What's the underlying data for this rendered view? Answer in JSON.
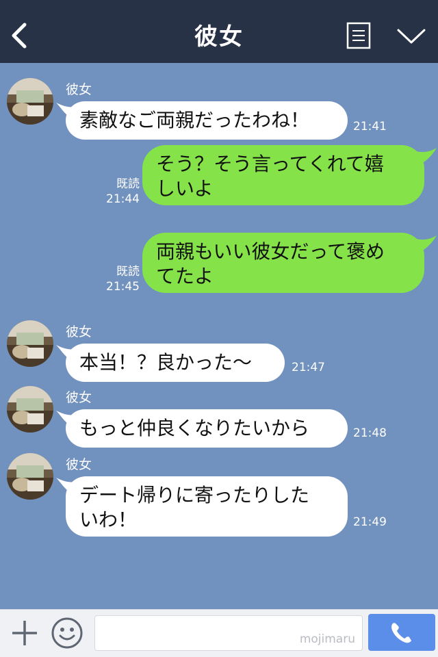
{
  "header": {
    "title": "彼女",
    "back_icon": "chevron-left-icon",
    "menu_icon": "memo-list-icon",
    "expand_icon": "chevron-down-icon"
  },
  "messages": [
    {
      "side": "left",
      "sender": "彼女",
      "lines": [
        "素敵なご両親だったわね！"
      ],
      "time": "21:41"
    },
    {
      "side": "right",
      "read": "既読",
      "lines": [
        "そう？そう言ってくれて嬉",
        "しいよ"
      ],
      "time": "21:44"
    },
    {
      "side": "right",
      "read": "既読",
      "lines": [
        "両親もいい彼女だって褒め",
        "てたよ"
      ],
      "time": "21:45"
    },
    {
      "side": "left",
      "sender": "彼女",
      "lines": [
        "本当！？良かった〜"
      ],
      "time": "21:47"
    },
    {
      "side": "left",
      "sender": "彼女",
      "lines": [
        "もっと仲良くなりたいから"
      ],
      "time": "21:48"
    },
    {
      "side": "left",
      "sender": "彼女",
      "lines": [
        "デート帰りに寄ったりした",
        "いわ！"
      ],
      "time": "21:49"
    }
  ],
  "bottom_bar": {
    "input_value": "",
    "watermark": "mojimaru",
    "plus_icon": "plus-icon",
    "emoji_icon": "smiley-face-icon",
    "call_icon": "phone-icon"
  },
  "colors": {
    "header_bg": "#273246",
    "chat_bg": "#7191bf",
    "sent_bubble": "#85e249",
    "received_bubble": "#ffffff",
    "call_button": "#5a8ee8"
  }
}
